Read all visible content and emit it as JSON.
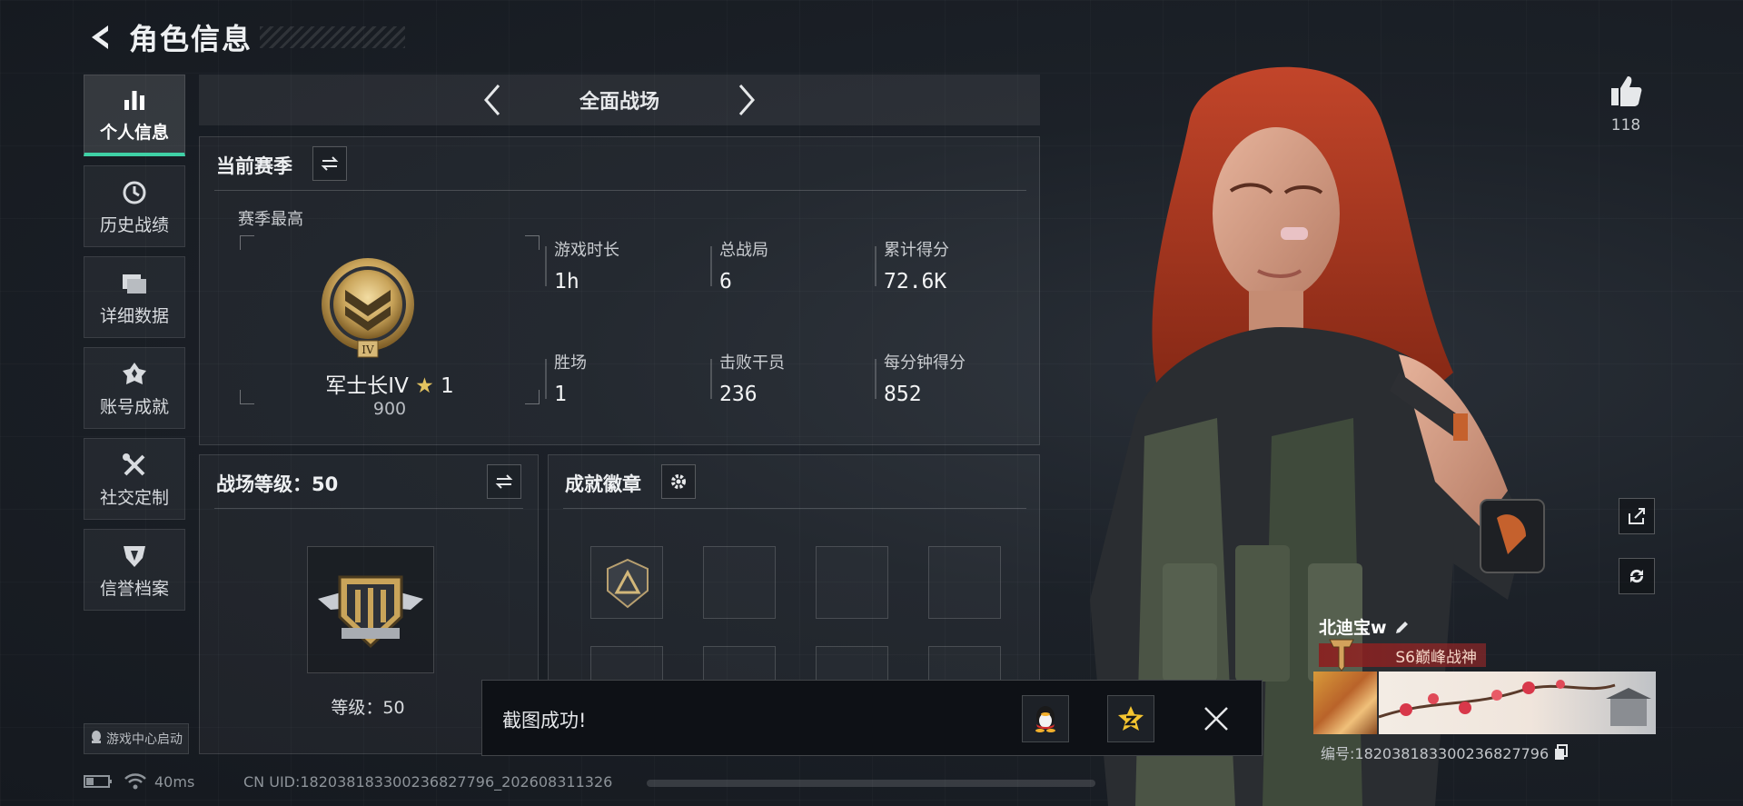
{
  "header": {
    "title": "角色信息"
  },
  "sidebar": {
    "items": [
      {
        "label": "个人信息",
        "icon": "bar-chart-icon"
      },
      {
        "label": "历史战绩",
        "icon": "clock-icon"
      },
      {
        "label": "详细数据",
        "icon": "folder-icon"
      },
      {
        "label": "账号成就",
        "icon": "achievement-icon"
      },
      {
        "label": "社交定制",
        "icon": "tools-icon"
      },
      {
        "label": "信誉档案",
        "icon": "shield-icon"
      }
    ],
    "launch": "游戏中心启动"
  },
  "mode": {
    "label": "全面战场"
  },
  "season": {
    "title": "当前赛季",
    "best_label": "赛季最高",
    "rank": "军士长IV",
    "stars": "1",
    "score": "900",
    "stats": [
      {
        "label": "游戏时长",
        "value": "1h"
      },
      {
        "label": "总战局",
        "value": "6"
      },
      {
        "label": "累计得分",
        "value": "72.6K"
      },
      {
        "label": "胜场",
        "value": "1"
      },
      {
        "label": "击败干员",
        "value": "236"
      },
      {
        "label": "每分钟得分",
        "value": "852"
      }
    ]
  },
  "battlefield": {
    "title": "战场等级：50",
    "level_text": "等级：50"
  },
  "badges": {
    "title": "成就徽章"
  },
  "toast": {
    "text": "截图成功!"
  },
  "profile": {
    "likes": "118",
    "name": "北迪宝w",
    "title_tag": "S6巅峰战神",
    "id_line": "编号:18203818330023682779​6"
  },
  "status": {
    "ping": "40ms",
    "uid": "CN UID:18203818330023682779​6_202608311326"
  },
  "colors": {
    "accent": "#3fd1a6",
    "gold": "#c9a45a",
    "title_red": "#8c1e1e"
  }
}
